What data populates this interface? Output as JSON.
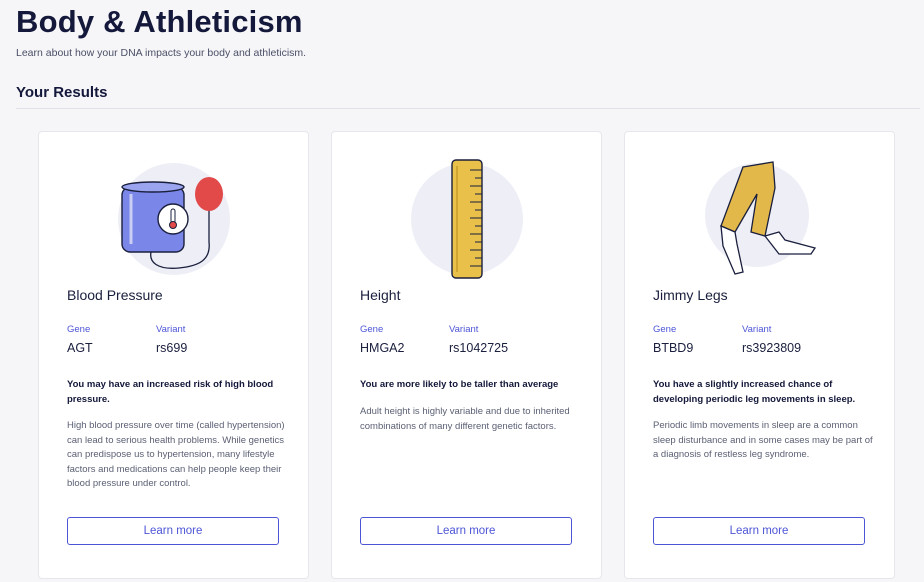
{
  "header": {
    "title": "Body & Athleticism",
    "subtitle": "Learn about how your DNA impacts your body and athleticism."
  },
  "section": {
    "title": "Your Results"
  },
  "labels": {
    "gene": "Gene",
    "variant": "Variant"
  },
  "cards": [
    {
      "title": "Blood Pressure",
      "gene": "AGT",
      "variant": "rs699",
      "summary": "You may have an increased risk of high blood pressure.",
      "description": "High blood pressure over time (called hypertension) can lead to serious health problems. While genetics can predispose us to hypertension, many lifestyle factors and medications can help people keep their blood pressure under control.",
      "button": "Learn more",
      "icon": "blood-pressure-cuff-icon"
    },
    {
      "title": "Height",
      "gene": "HMGA2",
      "variant": "rs1042725",
      "summary": "You are more likely to be taller than average",
      "description": "Adult height is highly variable and due to inherited combinations of many different genetic factors.",
      "button": "Learn more",
      "icon": "ruler-icon"
    },
    {
      "title": "Jimmy Legs",
      "gene": "BTBD9",
      "variant": "rs3923809",
      "summary": "You have a slightly increased chance of developing periodic leg movements in sleep.",
      "description": "Periodic limb movements in sleep are a common sleep disturbance and in some cases may be part of a diagnosis of restless leg syndrome.",
      "button": "Learn more",
      "icon": "legs-icon"
    }
  ],
  "colors": {
    "accent": "#4d55d6",
    "circle_bg": "#eeeff6",
    "cuff_blue": "#7a86e8",
    "bulb_red": "#e24a4a",
    "ruler_yellow": "#e8c04a",
    "pants_yellow": "#e3b84a"
  }
}
